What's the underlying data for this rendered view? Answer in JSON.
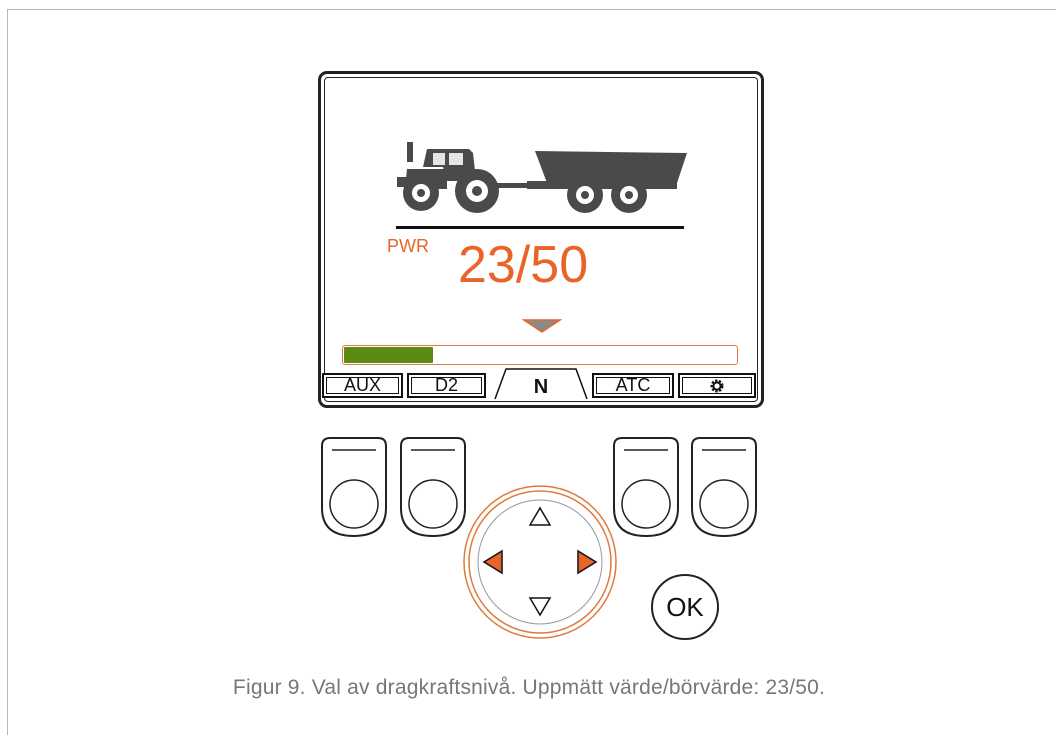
{
  "display": {
    "mode_label": "PWR",
    "level_text": "23/50",
    "level_fraction": 0.23,
    "softkeys": {
      "aux": "AUX",
      "d2": "D2",
      "center": "N",
      "atc": "ATC",
      "settings_icon": "gear-icon"
    }
  },
  "controls": {
    "ok_label": "OK"
  },
  "caption": "Figur 9. Val av dragkraftsnivå. Uppmätt värde/börvärde: 23/50.",
  "colors": {
    "accent": "#e8642a",
    "bar_fill": "#5c8a12",
    "marker": "#8a8a8a",
    "vehicle": "#4a4a4a"
  }
}
